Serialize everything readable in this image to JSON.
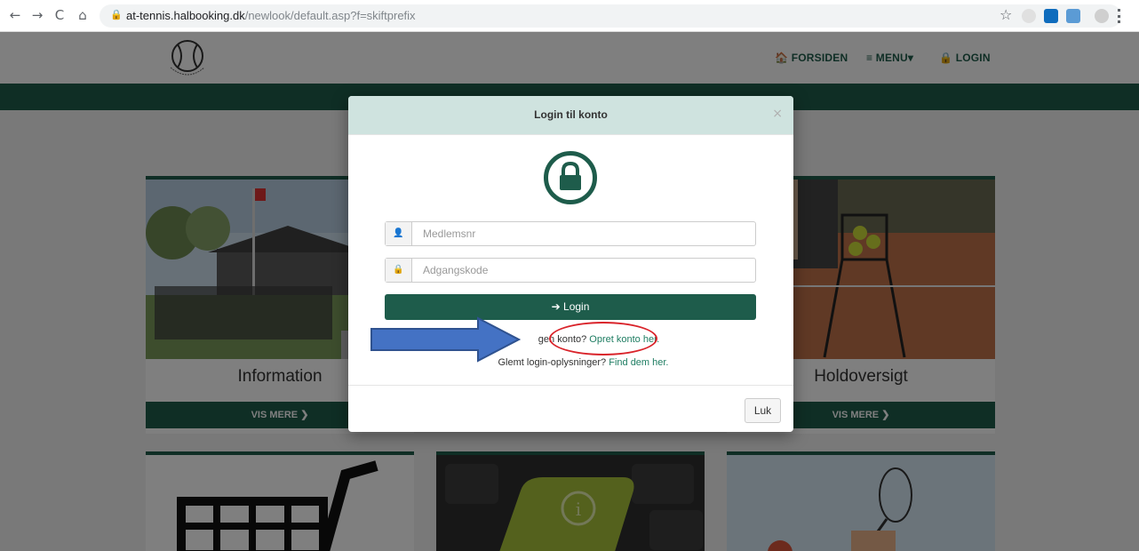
{
  "browser": {
    "back_icon": "←",
    "forward_icon": "→",
    "reload_icon": "C",
    "home_icon": "⌂",
    "lock_icon": "🔒",
    "host": "at-tennis.halbooking.dk",
    "path": "/newlook/default.asp?f=skiftprefix",
    "star_icon": "☆"
  },
  "site": {
    "nav": {
      "home_icon": "🏠",
      "home": "FORSIDEN",
      "menu_icon": "≡",
      "menu": "MENU",
      "menu_caret": "▾",
      "login_icon": "🔒",
      "login": "LOGIN"
    },
    "cards": [
      {
        "title": "Information",
        "button": "VIS MERE ❯"
      },
      {
        "title": "Holdoversigt",
        "button": "VIS MERE ❯"
      }
    ]
  },
  "modal": {
    "title": "Login til konto",
    "close": "×",
    "username_icon": "👤",
    "username_placeholder": "Medlemsnr",
    "password_icon": "🔒",
    "password_placeholder": "Adgangskode",
    "login_icon": "➔",
    "login_label": "Login",
    "no_account_text": "gen konto? ",
    "no_account_link": "Opret konto her.",
    "forgot_text": "Glemt login-oplysninger? ",
    "forgot_link": "Find dem her.",
    "close_button": "Luk"
  },
  "colors": {
    "brand": "#1e5c4b",
    "header_bg": "#cfe3df",
    "annotation_arrow": "#4472c4",
    "annotation_ellipse": "#d9232a"
  }
}
